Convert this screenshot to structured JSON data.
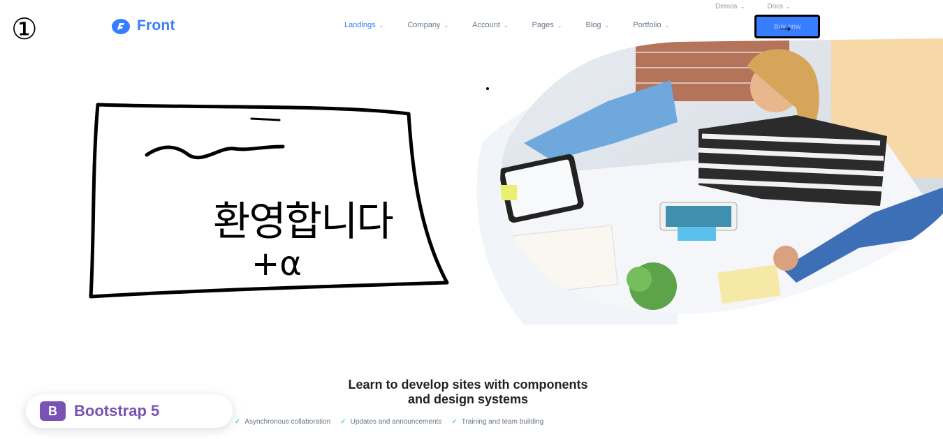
{
  "header": {
    "brand": "Front",
    "topbar": [
      {
        "label": "Demos"
      },
      {
        "label": "Docs"
      }
    ],
    "nav": [
      {
        "label": "Landings",
        "active": true
      },
      {
        "label": "Company"
      },
      {
        "label": "Account"
      },
      {
        "label": "Pages"
      },
      {
        "label": "Blog"
      },
      {
        "label": "Portfolio"
      }
    ],
    "buy_button": "Buy now"
  },
  "hero": {
    "image_alt": "team meeting photo"
  },
  "annotations": {
    "page_marker": "①",
    "welcome_text": "환영합니다",
    "alpha_text": "+α"
  },
  "section": {
    "headline_line1": "Learn to develop sites with components",
    "headline_line2": "and design systems",
    "features": [
      "Asynchronous collaboration",
      "Updates and announcements",
      "Training and team building"
    ],
    "badge": {
      "icon_letter": "B",
      "label": "Bootstrap 5"
    }
  },
  "colors": {
    "primary": "#377dff",
    "bootstrap_purple": "#7952b3",
    "check_green": "#00c9a7"
  }
}
